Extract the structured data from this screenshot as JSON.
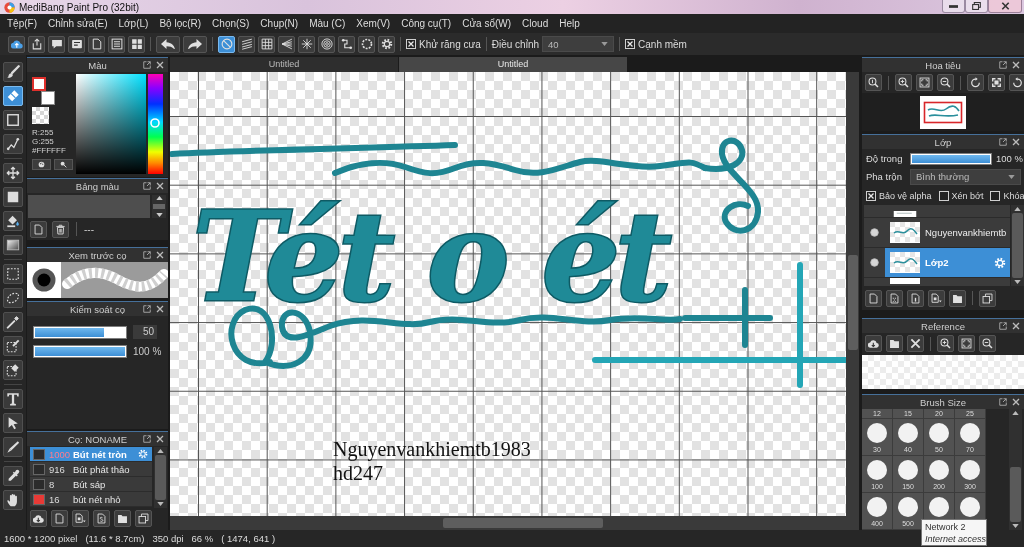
{
  "window": {
    "title": "MediBang Paint Pro (32bit)",
    "controls": [
      {
        "kind": "minimize"
      },
      {
        "kind": "maximize"
      },
      {
        "kind": "close_window"
      }
    ]
  },
  "menu": [
    "Tệp(F)",
    "Chỉnh sửa(E)",
    "Lớp(L)",
    "Bộ lọc(R)",
    "Chọn(S)",
    "Chụp(N)",
    "Màu (C)",
    "Xem(V)",
    "Công cụ(T)",
    "Cửa sổ(W)",
    "Cloud",
    "Help"
  ],
  "toolbar": {
    "file_buttons": [
      {
        "kind": "cloud"
      },
      {
        "kind": "upload"
      },
      {
        "kind": "comment"
      },
      {
        "kind": "caption"
      },
      {
        "kind": "page"
      },
      {
        "kind": "list"
      },
      {
        "kind": "tiles"
      }
    ],
    "history_buttons": [
      {
        "kind": "undo"
      },
      {
        "kind": "redo"
      }
    ],
    "snap_buttons": [
      {
        "kind": "snap_off",
        "selected": true
      },
      {
        "kind": "parallel",
        "selected": false
      },
      {
        "kind": "grid",
        "selected": false
      },
      {
        "kind": "vanish",
        "selected": false
      },
      {
        "kind": "radial",
        "selected": false
      },
      {
        "kind": "concentric",
        "selected": false
      },
      {
        "kind": "curve",
        "selected": false
      },
      {
        "kind": "ring",
        "selected": false
      },
      {
        "kind": "settings",
        "selected": false
      }
    ],
    "antialias": {
      "label": "Khử răng cưa",
      "checked": true
    },
    "adjust": {
      "label": "Điều chỉnh",
      "value": "40"
    },
    "soft_edge": {
      "label": "Cạnh mềm",
      "checked": true
    }
  },
  "tools": [
    [
      {
        "kind": "brush",
        "selected": false
      },
      {
        "kind": "eraser",
        "selected": true
      },
      {
        "kind": "shape",
        "selected": false
      },
      {
        "kind": "polyline",
        "selected": false
      }
    ],
    [
      {
        "kind": "move",
        "selected": false
      },
      {
        "kind": "fill",
        "selected": false
      },
      {
        "kind": "bucket",
        "selected": false
      },
      {
        "kind": "gradient",
        "selected": false
      }
    ],
    [
      {
        "kind": "select",
        "selected": false
      },
      {
        "kind": "lasso",
        "selected": false
      },
      {
        "kind": "wand",
        "selected": false
      },
      {
        "kind": "selpen",
        "selected": false
      },
      {
        "kind": "selerase",
        "selected": false
      }
    ],
    [
      {
        "kind": "text",
        "selected": false
      },
      {
        "kind": "pointer",
        "selected": false
      },
      {
        "kind": "knife",
        "selected": false
      }
    ],
    [
      {
        "kind": "eyedropper",
        "selected": false
      },
      {
        "kind": "hand",
        "selected": false
      }
    ]
  ],
  "color_panel": {
    "title": "Màu",
    "swatches": [
      {
        "color": "#ffffff",
        "selected": true
      },
      {
        "color": "#ffffff",
        "selected": false
      }
    ],
    "readouts": [
      "R:255",
      "G:255",
      "#FFFFFF"
    ],
    "hue_slider": {
      "level": 0.49
    },
    "buttons": [
      {
        "kind": "palette"
      },
      {
        "kind": "picker"
      }
    ]
  },
  "palette_panel": {
    "title": "Bảng màu",
    "buttons": [
      {
        "kind": "page"
      },
      {
        "kind": "trash"
      }
    ],
    "palette_name": "---"
  },
  "brush_preview": {
    "title": "Xem trước cọ"
  },
  "brush_control": {
    "title": "Kiểm soát cọ",
    "sliders": [
      {
        "kind": "boxed",
        "level": 0.77,
        "reading": "50"
      },
      {
        "kind": "plain",
        "level": 1,
        "reading": "100 %"
      }
    ]
  },
  "brush_list": {
    "title": "Cọ: NONAME",
    "brushes": [
      {
        "size": "1000",
        "name": "Bút nét tròn",
        "color": "#2b2b2b",
        "selected": true
      },
      {
        "size": "916",
        "name": "Bút phát thảo",
        "color": "#2b2b2b",
        "selected": false
      },
      {
        "size": "8",
        "name": "Bút sáp",
        "color": "#2b2b2b",
        "selected": false
      },
      {
        "size": "16",
        "name": "bút nét nhỏ",
        "color": "#e83a36",
        "selected": false
      }
    ],
    "buttons": [
      [
        {
          "kind": "cloud_down"
        },
        {
          "kind": "page"
        },
        {
          "kind": "page_menu"
        },
        {
          "kind": "script"
        },
        {
          "kind": "folder"
        },
        {
          "kind": "copy"
        }
      ]
    ]
  },
  "canvas": {
    "tabs": [
      {
        "label": "Untitled",
        "selected": false
      },
      {
        "label": "Untitled",
        "selected": true
      }
    ],
    "lettering": "Tét o ét",
    "text_layer": [
      "Nguyenvankhiemtb1983",
      "hd247"
    ]
  },
  "navigator": {
    "title": "Hoa tiêu",
    "buttons": [
      [
        {
          "kind": "zoom_reset"
        }
      ],
      [
        {
          "kind": "zoom_in"
        },
        {
          "kind": "fit"
        },
        {
          "kind": "zoom_out"
        }
      ],
      [
        {
          "kind": "rotate_left"
        },
        {
          "kind": "fullscreen"
        },
        {
          "kind": "rotate_right"
        }
      ]
    ]
  },
  "layers_panel": {
    "title": "Lớp",
    "opacity": {
      "label": "Độ trong",
      "level": 1,
      "reading": "100 %"
    },
    "blend": {
      "label": "Pha trộn",
      "value": "Bình thường"
    },
    "options": [
      {
        "label": "Bảo vệ alpha",
        "checked": true
      },
      {
        "label": "Xén bớt",
        "checked": false
      },
      {
        "label": "Khóa",
        "checked": false
      }
    ],
    "layers": [
      {
        "name": "Nguyenvankhiemtb",
        "visible": true,
        "selected": false
      },
      {
        "name": "Lớp2",
        "visible": true,
        "selected": true
      }
    ],
    "buttons": [
      [
        {
          "kind": "page"
        },
        {
          "kind": "page_dots"
        },
        {
          "kind": "page_mono"
        },
        {
          "kind": "page_menu"
        },
        {
          "kind": "folder"
        }
      ],
      [
        {
          "kind": "copy"
        }
      ]
    ]
  },
  "reference_panel": {
    "title": "Reference",
    "buttons": [
      [
        {
          "kind": "cloud_down"
        },
        {
          "kind": "folder"
        },
        {
          "kind": "close"
        }
      ],
      [
        {
          "kind": "zoom_in"
        },
        {
          "kind": "fit"
        },
        {
          "kind": "zoom_out"
        }
      ]
    ]
  },
  "brush_size_panel": {
    "title": "Brush Size",
    "scrolled_labels": [
      "12",
      "15",
      "20",
      "25"
    ],
    "rows": [
      [
        "30",
        "40",
        "50",
        "70"
      ],
      [
        "100",
        "150",
        "200",
        "300"
      ],
      [
        "400",
        "500"
      ]
    ]
  },
  "status_bar": [
    "1600 * 1200 pixel",
    "(11.6 * 8.7cm)",
    "350 dpi",
    "66 %",
    "( 1474, 641 )"
  ],
  "tooltip": {
    "title": "Network 2",
    "detail": "Internet access"
  }
}
